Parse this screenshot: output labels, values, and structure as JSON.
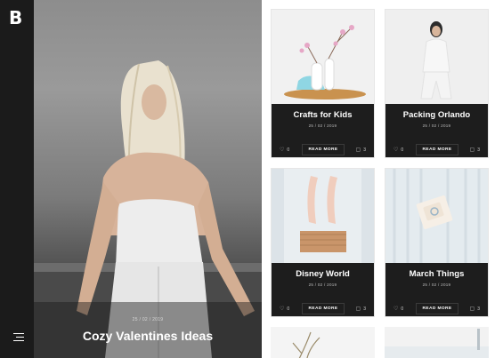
{
  "brand": {
    "logo": "B"
  },
  "hero": {
    "meta": "25 / 02 / 2019",
    "title": "Cozy Valentines Ideas"
  },
  "cards": [
    {
      "title": "Crafts for Kids",
      "date": "25 / 02 / 2019",
      "likes": "0",
      "cta": "READ MORE",
      "comments": "3"
    },
    {
      "title": "Packing Orlando",
      "date": "25 / 02 / 2019",
      "likes": "0",
      "cta": "READ MORE",
      "comments": "3"
    },
    {
      "title": "Disney World",
      "date": "25 / 02 / 2019",
      "likes": "0",
      "cta": "READ MORE",
      "comments": "3"
    },
    {
      "title": "March Things",
      "date": "25 / 02 / 2019",
      "likes": "0",
      "cta": "READ MORE",
      "comments": "3"
    }
  ],
  "icons": {
    "menu": "hamburger-menu-icon",
    "like": "heart-icon",
    "comment": "comment-icon"
  },
  "colors": {
    "sidebar": "#1b1b1b",
    "card": "#1d1d1d",
    "text": "#ffffff"
  }
}
